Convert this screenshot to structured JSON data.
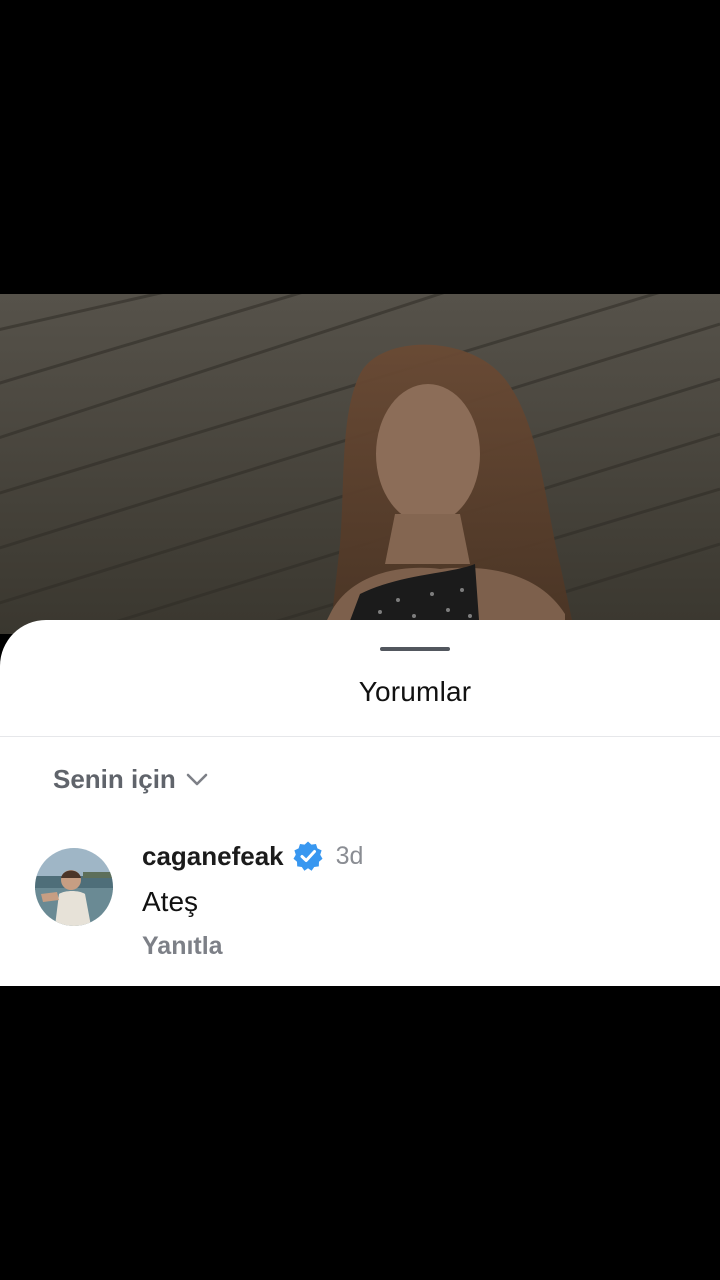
{
  "comments_sheet": {
    "title": "Yorumlar",
    "filter_label": "Senin için"
  },
  "comment": {
    "username": "caganefeak",
    "verified": true,
    "time": "3d",
    "text": "Ateş",
    "reply_label": "Yanıtla"
  },
  "icons": {
    "filter": "chevron-down-icon",
    "verified": "verified-badge-icon"
  },
  "colors": {
    "verified_blue": "#3897f0",
    "sheet_background": "#ffffff",
    "backdrop": "#000000"
  }
}
